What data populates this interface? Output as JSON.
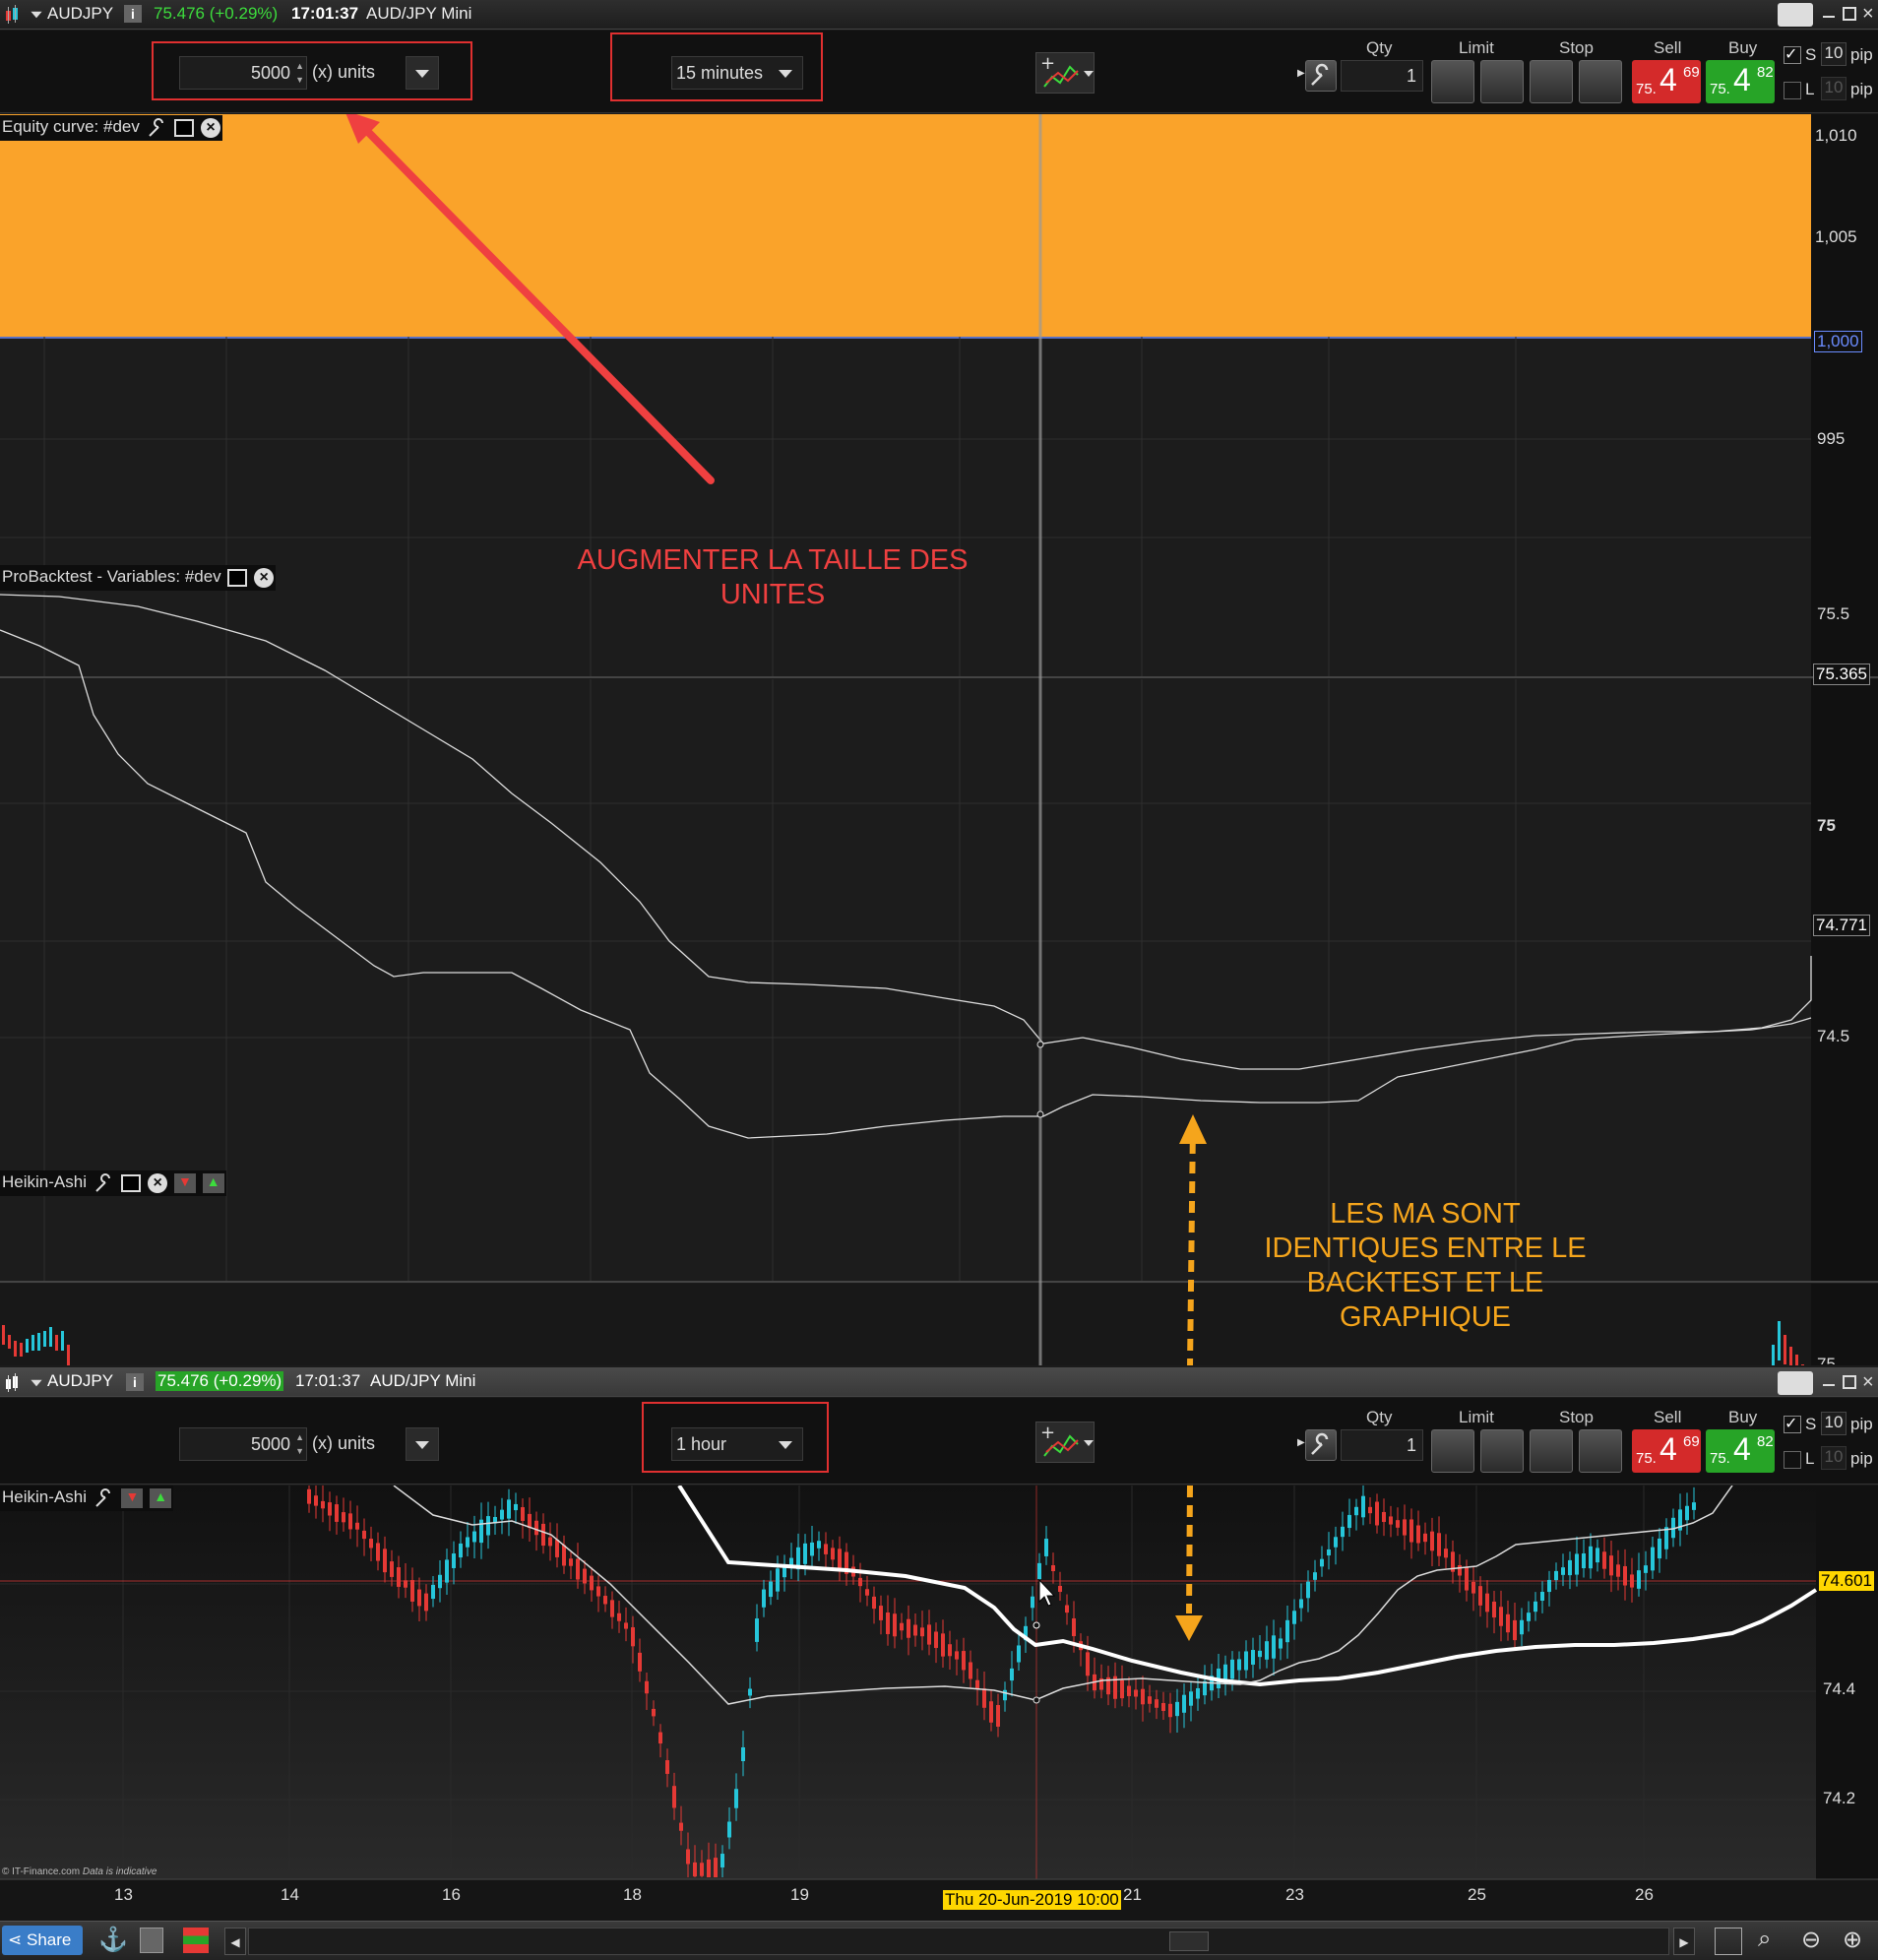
{
  "top_window": {
    "symbol": "AUDJPY",
    "price": "75.476 (+0.29%)",
    "time": "17:01:37",
    "instrument": "AUD/JPY Mini",
    "qty_field": "5000",
    "units_label": "(x) units",
    "timeframe": "15 minutes"
  },
  "bottom_window": {
    "symbol": "AUDJPY",
    "price": "75.476 (+0.29%)",
    "time": "17:01:37",
    "instrument": "AUD/JPY Mini",
    "qty_field": "5000",
    "units_label": "(x) units",
    "timeframe": "1 hour"
  },
  "trade_panel": {
    "qty_label": "Qty",
    "qty_value": "1",
    "limit_label": "Limit",
    "stop_label": "Stop",
    "sell_label": "Sell",
    "buy_label": "Buy",
    "sell_price": {
      "prefix": "75.",
      "big": "4",
      "small": "69"
    },
    "buy_price": {
      "prefix": "75.",
      "big": "4",
      "small": "82"
    },
    "s_label": "S",
    "l_label": "L",
    "pips_value": "10",
    "pips_unit": "pip"
  },
  "panels": {
    "equity_label": "Equity curve: #dev",
    "backtest_label": "ProBacktest - Variables: #dev",
    "heikin_label": "Heikin-Ashi",
    "heikin_label_lower": "Heikin-Ashi"
  },
  "equity_axis": [
    "1,010",
    "1,005",
    "1,000",
    "995"
  ],
  "backtest_axis": [
    "75.5",
    "75.365",
    "75",
    "74.771",
    "74.5"
  ],
  "heikin_top_axis": [
    "75"
  ],
  "lower_axis": [
    "74.601",
    "74.4",
    "74.2"
  ],
  "x_axis": [
    "13",
    "14",
    "16",
    "18",
    "19",
    "21",
    "23",
    "25",
    "26"
  ],
  "crosshair_date": "Thu 20-Jun-2019 10:00",
  "annotations": {
    "units_note": "AUGMENTER LA TAILLE DES UNITES",
    "ma_note": "LES MA SONT IDENTIQUES ENTRE LE BACKTEST ET LE GRAPHIQUE"
  },
  "footer": {
    "credit": "© IT-Finance.com",
    "credit_note": "Data is indicative",
    "share_label": "Share"
  },
  "colors": {
    "equity_fill": "#faa32a",
    "sell": "#d42a2a",
    "buy": "#27a427",
    "up_candle": "#26c6da",
    "down_candle": "#e53935",
    "annotation_red": "#ef4040",
    "annotation_orange": "#f5a51c",
    "price_tag": "#ffd700"
  }
}
